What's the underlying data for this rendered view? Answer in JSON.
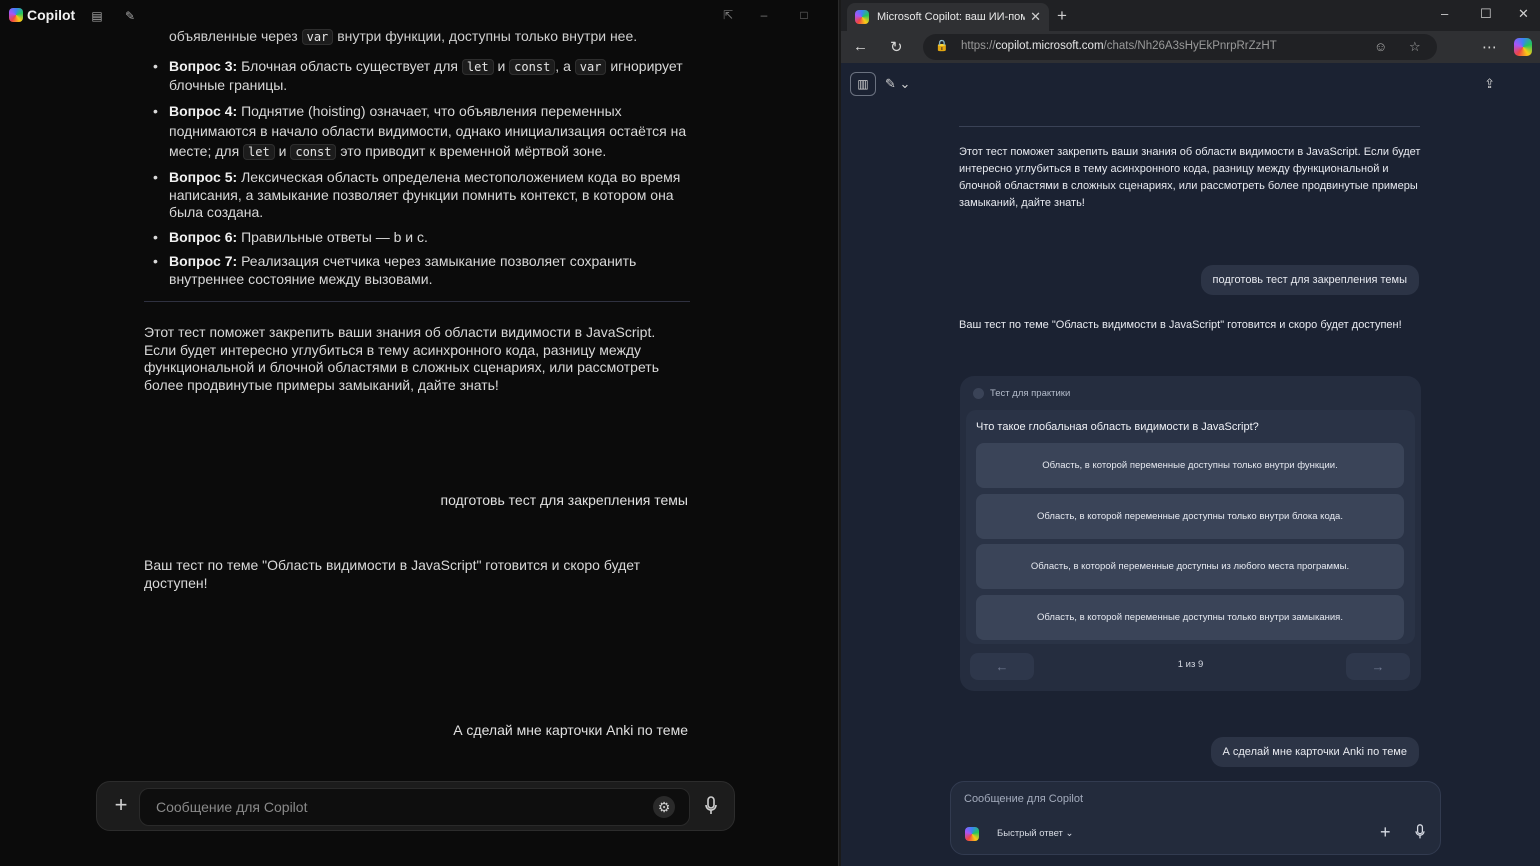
{
  "left_app": {
    "app_name": "Copilot",
    "partial_line_prefix": "объявленные через",
    "partial_line_code": "var",
    "partial_line_suffix": "внутри функции, доступны только внутри нее.",
    "answers": [
      {
        "label": "Вопрос 3:",
        "p1": "Блочная область существует для",
        "c1": "let",
        "p2": "и",
        "c2": "const",
        "p3": ", а",
        "c3": "var",
        "p4": "игнорирует блочные границы."
      },
      {
        "label": "Вопрос 4:",
        "p1": "Поднятие (hoisting) означает, что объявления переменных поднимаются в начало области видимости, однако инициализация остаётся на месте; для",
        "c1": "let",
        "p2": "и",
        "c2": "const",
        "p3": "это приводит к временной мёртвой зоне."
      },
      {
        "label": "Вопрос 5:",
        "text": "Лексическая область определена местоположением кода во время написания, а замыкание позволяет функции помнить контекст, в котором она была создана."
      },
      {
        "label": "Вопрос 6:",
        "text": "Правильные ответы — b и c."
      },
      {
        "label": "Вопрос 7:",
        "text": "Реализация счетчика через замыкание позволяет сохранить внутреннее состояние между вызовами."
      }
    ],
    "closing_paragraph": "Этот тест поможет закрепить ваши знания об области видимости в JavaScript. Если будет интересно углубиться в тему асинхронного кода, разницу между функциональной и блочной областями в сложных сценариях, или рассмотреть более продвинутые примеры замыканий, дайте знать!",
    "user_message_1": "подготовь тест для закрепления темы",
    "assistant_reply_1": "Ваш тест по теме \"Область видимости в JavaScript\" готовится и скоро будет доступен!",
    "user_message_2": "А сделай мне карточки Anki по теме",
    "composer_placeholder": "Сообщение для Copilot"
  },
  "browser": {
    "tab_title": "Microsoft Copilot: ваш ИИ-помощник",
    "url_prefix": "https://",
    "url_host": "copilot.microsoft.com",
    "url_path": "/chats/Nh26A3sHyEkPnrpRrZzHT"
  },
  "right_page": {
    "closing_paragraph": "Этот тест поможет закрепить ваши знания об области видимости в JavaScript. Если будет интересно углубиться в тему асинхронного кода, разницу между функциональной и блочной областями в сложных сценариях, или рассмотреть более продвинутые примеры замыканий, дайте знать!",
    "user_message_1": "подготовь тест для закрепления темы",
    "assistant_reply_1": "Ваш тест по теме \"Область видимости в JavaScript\" готовится и скоро будет доступен!",
    "quiz": {
      "header": "Тест для практики",
      "question": "Что такое глобальная область видимости в JavaScript?",
      "options": [
        "Область, в которой переменные доступны только внутри функции.",
        "Область, в которой переменные доступны только внутри блока кода.",
        "Область, в которой переменные доступны из любого места программы.",
        "Область, в которой переменные доступны только внутри замыкания."
      ],
      "counter": "1 из 9"
    },
    "user_message_2": "А сделай мне карточки Anki по теме",
    "composer_placeholder": "Сообщение для Copilot",
    "mode_label": "Быстрый ответ"
  },
  "icons": {
    "sidebar": "sidebar-icon",
    "new_chat": "new-chat-icon",
    "share": "share-icon",
    "mic": "mic-icon",
    "plus": "plus-icon"
  }
}
